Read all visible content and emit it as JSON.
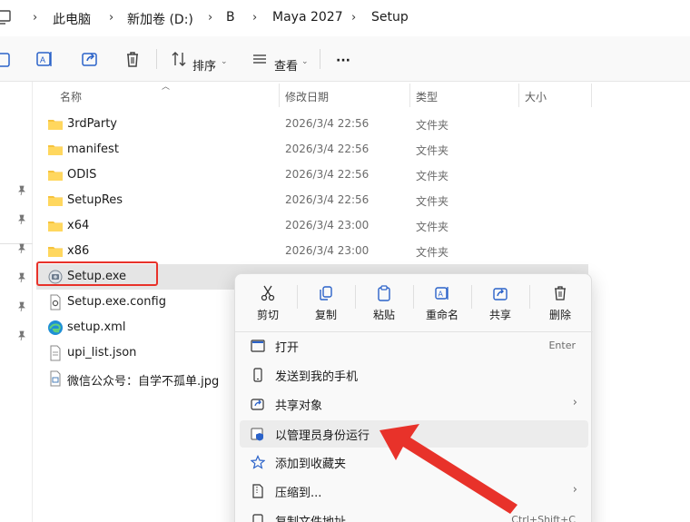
{
  "breadcrumb": {
    "items": [
      "此电脑",
      "新加卷 (D:)",
      "B",
      "Maya 2027",
      "Setup"
    ],
    "separator": "›"
  },
  "toolbar": {
    "sort_label": "排序",
    "view_label": "查看",
    "more_label": "···"
  },
  "columns": {
    "name": "名称",
    "modified": "修改日期",
    "type": "类型",
    "size": "大小"
  },
  "files": [
    {
      "name": "3rdParty",
      "date": "2026/3/4 22:56",
      "type": "文件夹",
      "icon": "folder-icon"
    },
    {
      "name": "manifest",
      "date": "2026/3/4 22:56",
      "type": "文件夹",
      "icon": "folder-icon"
    },
    {
      "name": "ODIS",
      "date": "2026/3/4 22:56",
      "type": "文件夹",
      "icon": "folder-icon"
    },
    {
      "name": "SetupRes",
      "date": "2026/3/4 22:56",
      "type": "文件夹",
      "icon": "folder-icon"
    },
    {
      "name": "x64",
      "date": "2026/3/4 23:00",
      "type": "文件夹",
      "icon": "folder-icon"
    },
    {
      "name": "x86",
      "date": "2026/3/4 23:00",
      "type": "文件夹",
      "icon": "folder-icon"
    },
    {
      "name": "Setup.exe",
      "date": "",
      "type": "",
      "icon": "setup-exe-icon"
    },
    {
      "name": "Setup.exe.config",
      "date": "",
      "type": "",
      "icon": "config-file-icon"
    },
    {
      "name": "setup.xml",
      "date": "",
      "type": "",
      "icon": "edge-icon"
    },
    {
      "name": "upi_list.json",
      "date": "",
      "type": "",
      "icon": "text-file-icon"
    },
    {
      "name": "微信公众号：自学不孤单.jpg",
      "date": "",
      "type": "",
      "icon": "image-file-icon"
    }
  ],
  "context_menu": {
    "top_actions": [
      {
        "label": "剪切",
        "icon": "scissors-icon"
      },
      {
        "label": "复制",
        "icon": "copy-icon"
      },
      {
        "label": "粘贴",
        "icon": "paste-icon"
      },
      {
        "label": "重命名",
        "icon": "rename-icon"
      },
      {
        "label": "共享",
        "icon": "share-icon"
      },
      {
        "label": "删除",
        "icon": "trash-icon"
      }
    ],
    "items": [
      {
        "label": "打开",
        "shortcut": "Enter",
        "icon": "open-window-icon"
      },
      {
        "label": "发送到我的手机",
        "shortcut": "",
        "icon": "phone-icon"
      },
      {
        "label": "共享对象",
        "shortcut": "",
        "icon": "share-arrow-icon",
        "submenu": true
      },
      {
        "label": "以管理员身份运行",
        "shortcut": "",
        "icon": "admin-shield-icon",
        "hover": true
      },
      {
        "label": "添加到收藏夹",
        "shortcut": "",
        "icon": "star-icon"
      },
      {
        "label": "压缩到...",
        "shortcut": "",
        "icon": "zip-icon",
        "submenu": true
      },
      {
        "label": "复制文件地址",
        "shortcut": "Ctrl+Shift+C",
        "icon": "copy-path-icon"
      }
    ]
  },
  "colors": {
    "highlight_box": "#e8322a",
    "arrow": "#e8322a",
    "folder": "#f6c33d"
  }
}
